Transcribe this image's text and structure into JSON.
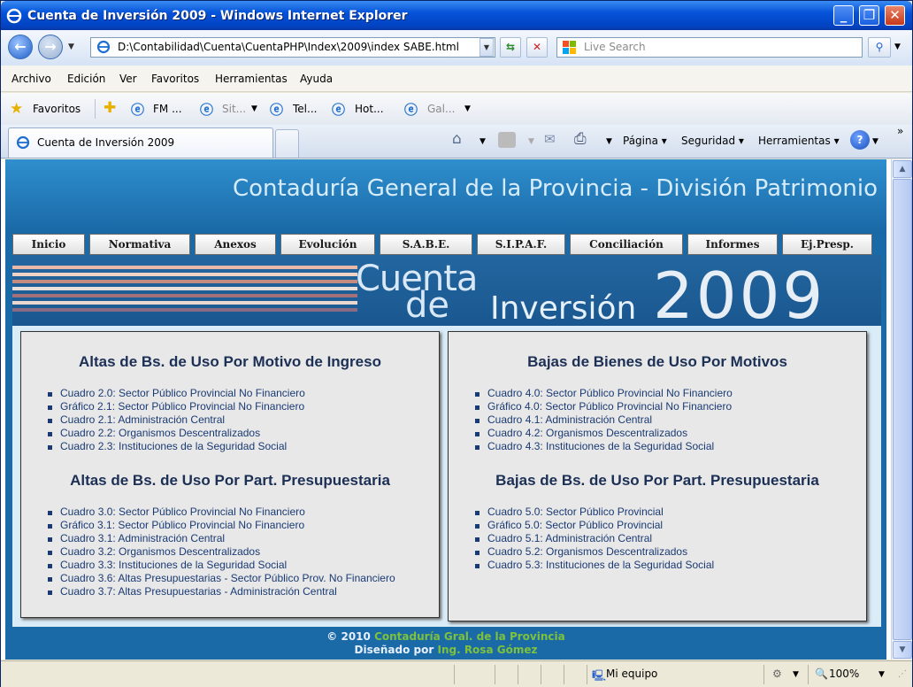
{
  "window": {
    "title": "Cuenta de Inversión 2009 - Windows Internet Explorer"
  },
  "address": {
    "url": "D:\\Contabilidad\\Cuenta\\CuentaPHP\\Index\\2009\\index SABE.html",
    "search_placeholder": "Live Search"
  },
  "menu": [
    "Archivo",
    "Edición",
    "Ver",
    "Favoritos",
    "Herramientas",
    "Ayuda"
  ],
  "favorites_bar": {
    "favorites_label": "Favoritos",
    "items": [
      "FM ...",
      "Sit...",
      "Tel...",
      "Hot...",
      "Gal..."
    ]
  },
  "tab": {
    "label": "Cuenta de Inversión 2009"
  },
  "commandbar": {
    "pagina": "Página",
    "seguridad": "Seguridad",
    "herramientas": "Herramientas"
  },
  "site": {
    "header_title": "Contaduría General de la Provincia - División Patrimonio",
    "nav": [
      "Inicio",
      "Normativa",
      "Anexos",
      "Evolución",
      "S.A.B.E.",
      "S.I.P.A.F.",
      "Conciliación",
      "Informes",
      "Ej.Presp."
    ],
    "banner": {
      "line1": "Cuenta",
      "line2": "de",
      "line3": "Inversión",
      "year": "2009"
    },
    "left_panel": {
      "heading1": "Altas de Bs. de Uso Por Motivo de Ingreso",
      "list1": [
        "Cuadro 2.0: Sector Público Provincial No Financiero",
        "Gráfico 2.1: Sector Público Provincial No Financiero",
        "Cuadro 2.1: Administración Central",
        "Cuadro 2.2: Organismos Descentralizados",
        "Cuadro 2.3: Instituciones de la Seguridad Social"
      ],
      "heading2": "Altas de Bs. de Uso Por Part. Presupuestaria",
      "list2": [
        "Cuadro 3.0: Sector Público Provincial No Financiero",
        "Gráfico 3.1: Sector Público Provincial No Financiero",
        "Cuadro 3.1: Administración Central",
        "Cuadro 3.2: Organismos Descentralizados",
        "Cuadro 3.3: Instituciones de la Seguridad Social",
        "Cuadro 3.6: Altas Presupuestarias - Sector Público Prov. No Financiero",
        "Cuadro 3.7: Altas Presupuestarias - Administración Central"
      ]
    },
    "right_panel": {
      "heading1": "Bajas de Bienes de Uso Por Motivos",
      "list1": [
        "Cuadro 4.0: Sector Público Provincial No Financiero",
        "Gráfico 4.0: Sector Público Provincial No Financiero",
        "Cuadro 4.1: Administración Central",
        "Cuadro 4.2: Organismos Descentralizados",
        "Cuadro 4.3: Instituciones de la Seguridad Social"
      ],
      "heading2": "Bajas de Bs. de Uso Por Part. Presupuestaria",
      "list2": [
        "Cuadro 5.0: Sector Público Provincial",
        "Gráfico 5.0: Sector Público Provincial",
        "Cuadro 5.1: Administración Central",
        "Cuadro 5.2: Organismos Descentralizados",
        "Cuadro 5.3: Instituciones de la Seguridad Social"
      ]
    },
    "footer": {
      "copyright": "© 2010",
      "org": "Contaduría Gral. de la Provincia",
      "designed_by": "Diseñado por",
      "designer": "Ing. Rosa Gómez"
    }
  },
  "status": {
    "zone": "Mi equipo",
    "zoom": "100%"
  },
  "colors": {
    "site_blue": "#1b6aa8",
    "heading_navy": "#1c2f55",
    "link_blue": "#1a3a73",
    "footer_green": "#7dc23a"
  }
}
